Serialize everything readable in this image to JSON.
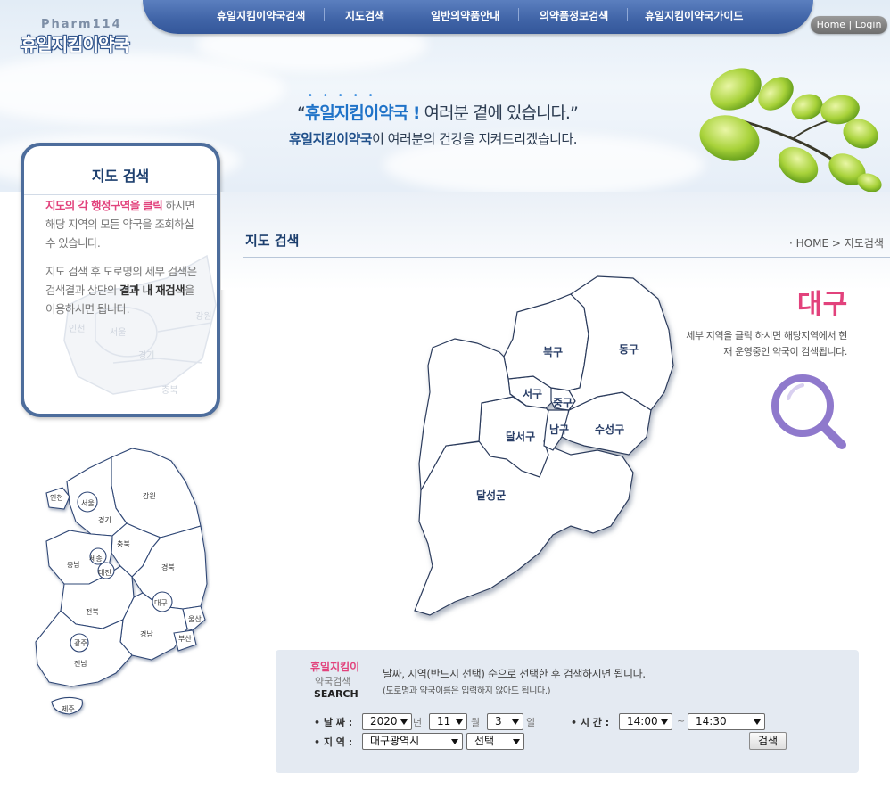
{
  "header": {
    "logo_sub": "Pharm114",
    "logo_main": "휴일지킴이약국",
    "nav": [
      {
        "label": "휴일지킴이약국검색"
      },
      {
        "label": "지도검색"
      },
      {
        "label": "일반의약품안내"
      },
      {
        "label": "의약품정보검색"
      },
      {
        "label": "휴일지킴이약국가이드"
      }
    ],
    "home_label": "Home",
    "login_label": "Login",
    "slogan": {
      "line1_open": "“",
      "line1_highlight": "휴일지킴이약국 !",
      "line1_rest": " 여러분 곁에 있습니다.”",
      "line2_highlight": "휴일지킴이약국",
      "line2_rest": "이 여러분의 건강을 지켜드리겠습니다."
    }
  },
  "sidebar": {
    "title": "지도 검색",
    "text1_highlight": "지도의 각 행정구역을 클릭",
    "text1_rest": " 하시면 해당 지역의 모든 약국을 조회하실 수 있습니다.",
    "text2_a": "지도 검색 후 도로명의 세부 검색은 검색결과 상단의 ",
    "text2_bold": "결과 내 재검색",
    "text2_b": "을 이용하시면 됩니다.",
    "bg_map_labels": [
      "인천",
      "서울",
      "강원",
      "경기",
      "충북"
    ],
    "korea_map_labels": [
      "인천",
      "서울",
      "경기",
      "강원",
      "충북",
      "세종",
      "충남",
      "대전",
      "경북",
      "대구",
      "전북",
      "울산",
      "광주",
      "경남",
      "부산",
      "전남",
      "제주"
    ]
  },
  "content": {
    "page_title": "지도 검색",
    "breadcrumb_home": "HOME",
    "breadcrumb_sep": ">",
    "breadcrumb_current": "지도검색",
    "region_name": "대구",
    "region_desc": "세부 지역을 클릭 하시면 해당지역에서 현재 운영중인 약국이 검색됩니다.",
    "districts": [
      "북구",
      "동구",
      "서구",
      "중구",
      "달서구",
      "남구",
      "수성구",
      "달성군"
    ]
  },
  "search": {
    "brand_line1": "휴일지킴이",
    "brand_line2": "약국검색",
    "brand_line3": "SEARCH",
    "desc_line1": "날짜, 지역(반드시 선택) 순으로 선택한 후 검색하시면 됩니다.",
    "desc_line2": "(도로명과 약국이름은 입력하지 않아도 됩니다.)",
    "date_label": "• 날 짜 :",
    "year": "2020",
    "year_unit": "년",
    "month": "11",
    "month_unit": "월",
    "day": "3",
    "day_unit": "일",
    "time_label": "• 시 간 :",
    "time_from": "14:00",
    "time_sep": "~",
    "time_to": "14:30",
    "region_label": "• 지 역 :",
    "region_value": "대구광역시",
    "subregion_value": "선택",
    "search_button": "검색"
  },
  "colors": {
    "nav_bg": "#3f63a6",
    "title_navy": "#1d3f6e",
    "accent_pink": "#e2427c",
    "highlight_blue": "#1f73c8"
  }
}
